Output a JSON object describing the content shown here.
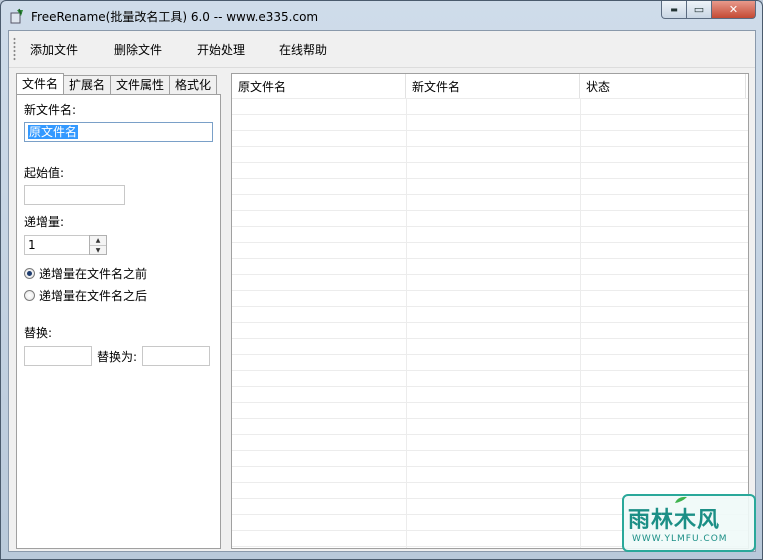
{
  "window": {
    "title": "FreeRename(批量改名工具) 6.0    --    www.e335.com",
    "controls": {
      "minimize": "▬",
      "maximize": "▭",
      "close": "✕"
    }
  },
  "toolbar": {
    "add_files": "添加文件",
    "remove_files": "删除文件",
    "start": "开始处理",
    "help": "在线帮助"
  },
  "tabs": [
    {
      "label": "文件名",
      "active": true
    },
    {
      "label": "扩展名",
      "active": false
    },
    {
      "label": "文件属性",
      "active": false
    },
    {
      "label": "格式化",
      "active": false
    }
  ],
  "filename_panel": {
    "new_name_label": "新文件名:",
    "new_name_value": "原文件名",
    "start_value_label": "起始值:",
    "start_value": "",
    "increment_label": "递增量:",
    "increment_value": "1",
    "radio_before": "递增量在文件名之前",
    "radio_after": "递增量在文件名之后",
    "replace_label": "替换:",
    "replace_value": "",
    "replace_with_label": "替换为:",
    "replace_with_value": ""
  },
  "file_list": {
    "columns": [
      "原文件名",
      "新文件名",
      "状态"
    ],
    "rows": []
  },
  "watermark": {
    "logo": "雨林木风",
    "url": "WWW.YLMFU.COM"
  },
  "colors": {
    "selection": "#3399ff",
    "close_button": "#c44a34",
    "watermark": "#1c8f86"
  }
}
